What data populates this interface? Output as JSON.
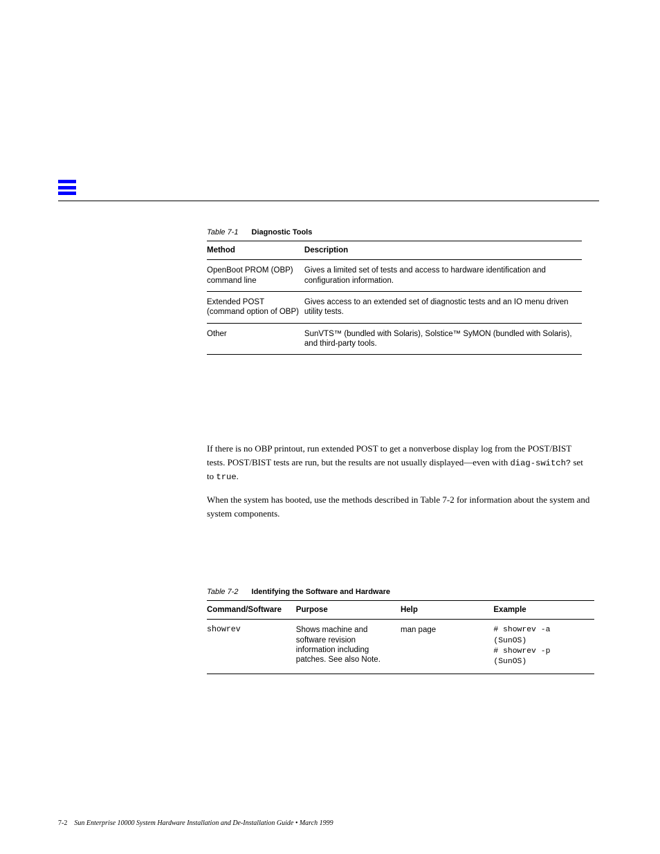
{
  "icon": {
    "name": "menu-bars"
  },
  "table1": {
    "caption_num": "Table 7-1",
    "caption_title": "Diagnostic Tools",
    "headers": [
      "Method",
      "Description"
    ],
    "rows": [
      {
        "c1": "OpenBoot PROM (OBP)\ncommand line",
        "c2": "Gives a limited set of tests and access to hardware identification and configuration information."
      },
      {
        "c1": "Extended POST\n(command option of OBP)",
        "c2": "Gives access to an extended set of diagnostic tests and an IO menu driven utility tests."
      },
      {
        "c1": "Other",
        "c2": "SunVTS™ (bundled with Solaris), Solstice™ SyMON (bundled with Solaris), and third-party tools."
      }
    ]
  },
  "intro_text": {
    "p1": "If there is no OBP printout, run extended POST to get a nonverbose display log from the POST/BIST tests. POST/BIST tests are run, but the results are not usually displayed—even with ",
    "p1_mono": "diag-switch?",
    "p1_after": " set to ",
    "p1_mono2": "true",
    "p1_end": ".",
    "p2_prefix": "When the system has booted, use the methods described in ",
    "p2_link": "Table 7-2",
    "p2_suffix": " for information about the system and system components."
  },
  "table2": {
    "caption_num": "Table 7-2",
    "caption_title": "Identifying the Software and Hardware",
    "headers": [
      "Command/Software",
      "Purpose",
      "Help",
      "Example"
    ],
    "rows": [
      {
        "cmd": {
          "text": "showrev",
          "mono": true
        },
        "purpose": "Shows machine and software revision information including patches. See also Note.",
        "help": "man page",
        "example": "# showrev -a\n(SunOS)\n# showrev -p\n(SunOS)"
      }
    ]
  },
  "footer": {
    "left_pagenum": "7-2",
    "left_text": "Sun Enterprise 10000 System Hardware Installation and De-Installation Guide • March 1999",
    "right_text": ""
  }
}
